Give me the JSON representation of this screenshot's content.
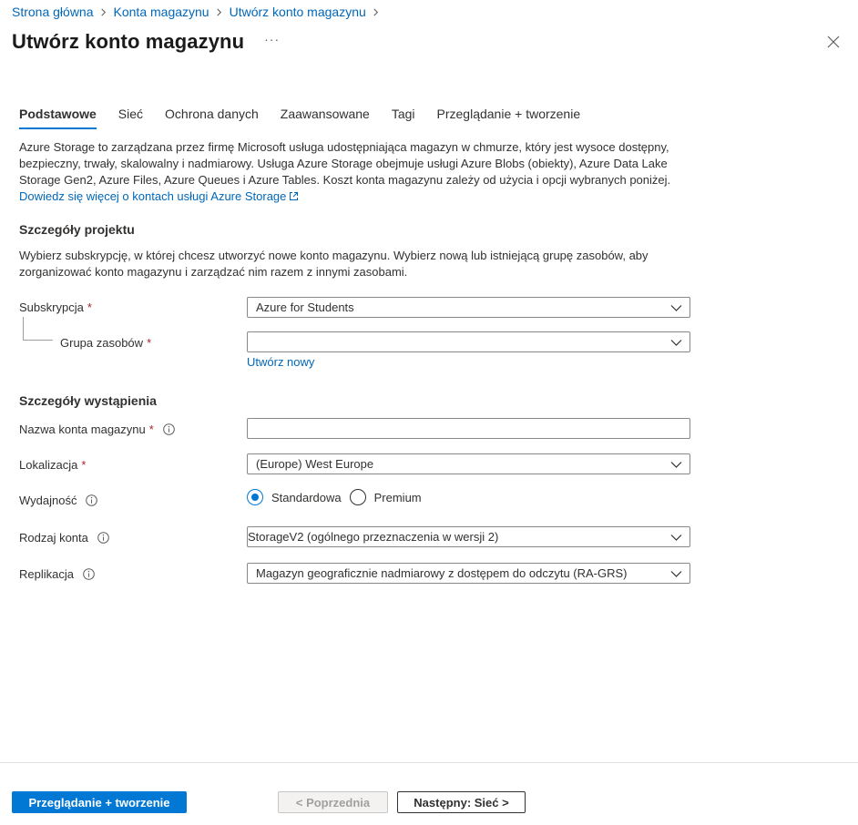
{
  "breadcrumb": {
    "items": [
      "Strona główna",
      "Konta magazynu",
      "Utwórz konto magazynu"
    ]
  },
  "header": {
    "title": "Utwórz konto magazynu",
    "more": "···"
  },
  "tabs": [
    {
      "label": "Podstawowe",
      "active": true
    },
    {
      "label": "Sieć"
    },
    {
      "label": "Ochrona danych"
    },
    {
      "label": "Zaawansowane"
    },
    {
      "label": "Tagi"
    },
    {
      "label": "Przeglądanie + tworzenie"
    }
  ],
  "intro": {
    "text": "Azure Storage to zarządzana przez firmę Microsoft usługa udostępniająca magazyn w chmurze, który jest wysoce dostępny, bezpieczny, trwały, skalowalny i nadmiarowy. Usługa Azure Storage obejmuje usługi Azure Blobs (obiekty), Azure Data Lake Storage Gen2, Azure Files, Azure Queues i Azure Tables. Koszt konta magazynu zależy od użycia i opcji wybranych poniżej.",
    "link": "Dowiedz się więcej o kontach usługi Azure Storage"
  },
  "project": {
    "title": "Szczegóły projektu",
    "description": "Wybierz subskrypcję, w której chcesz utworzyć nowe konto magazynu. Wybierz nową lub istniejącą grupę zasobów, aby zorganizować konto magazynu i zarządzać nim razem z innymi zasobami.",
    "subscription_label": "Subskrypcja",
    "subscription_value": "Azure for Students",
    "resource_group_label": "Grupa zasobów",
    "resource_group_value": "",
    "create_new": "Utwórz nowy"
  },
  "instance": {
    "title": "Szczegóły wystąpienia",
    "name_label": "Nazwa konta magazynu",
    "name_value": "",
    "location_label": "Lokalizacja",
    "location_value": "(Europe) West Europe",
    "performance_label": "Wydajność",
    "performance_options": [
      "Standardowa",
      "Premium"
    ],
    "performance_selected": "Standardowa",
    "account_kind_label": "Rodzaj konta",
    "account_kind_value": "StorageV2 (ogólnego przeznaczenia w wersji 2)",
    "replication_label": "Replikacja",
    "replication_value": "Magazyn geograficznie nadmiarowy z dostępem do odczytu (RA-GRS)"
  },
  "required_marker": "*",
  "footer": {
    "review_create": "Przeglądanie + tworzenie",
    "previous": "< Poprzednia",
    "next": "Następny: Sieć >"
  },
  "colors": {
    "accent": "#0078d4",
    "link": "#0067b8",
    "required": "#a4262c"
  },
  "icons": [
    "chevron-right-icon",
    "close-icon",
    "external-link-icon",
    "info-icon",
    "chevron-down-icon"
  ]
}
